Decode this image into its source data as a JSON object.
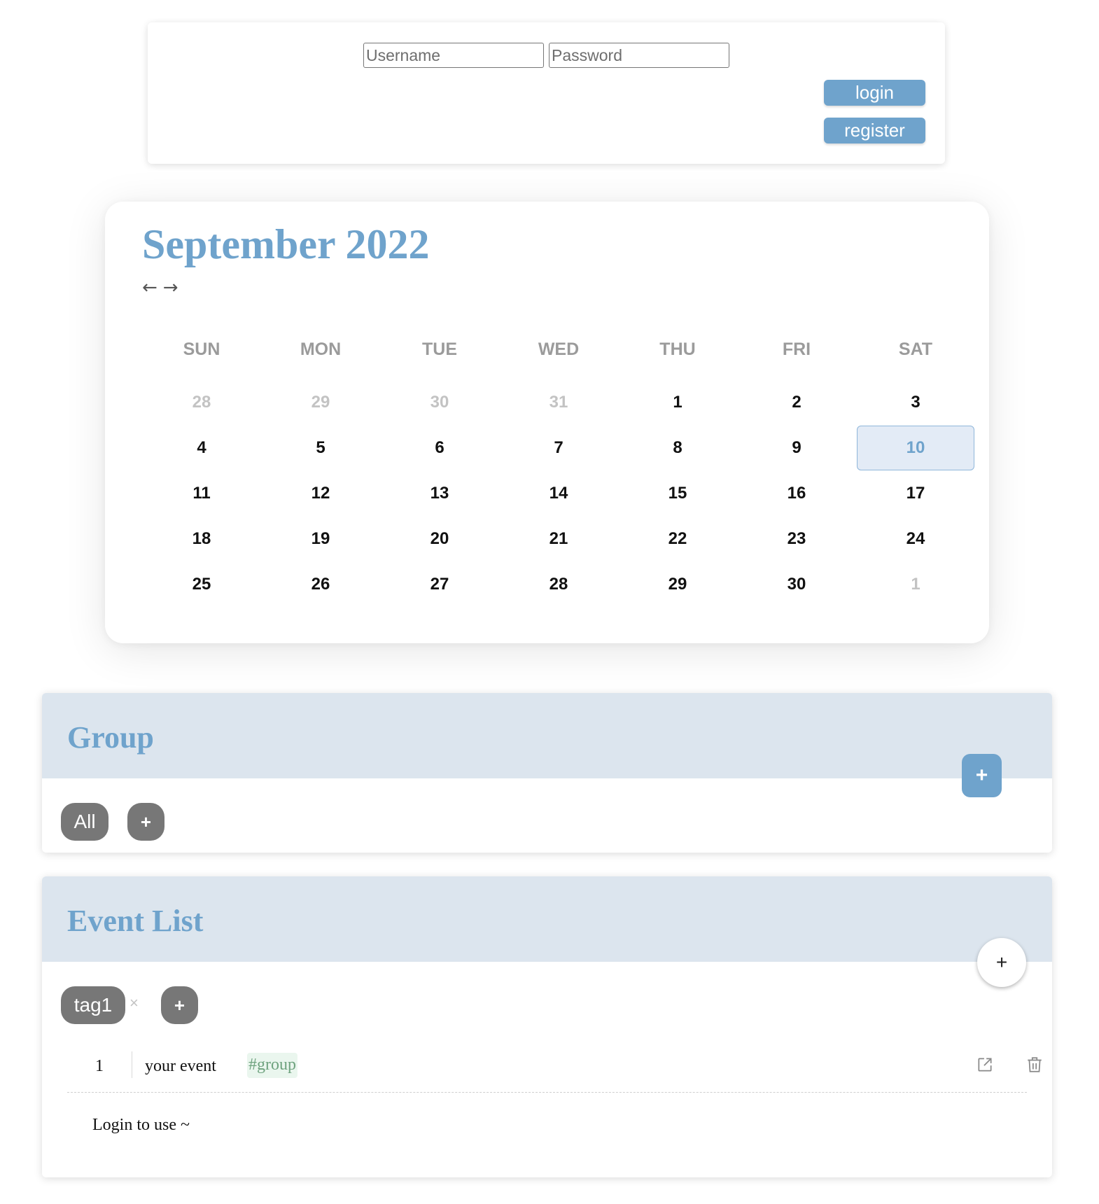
{
  "login": {
    "username_placeholder": "Username",
    "password_placeholder": "Password",
    "login_label": "login",
    "register_label": "register"
  },
  "calendar": {
    "title": "September 2022",
    "prev_arrow": "←",
    "next_arrow": "→",
    "weekdays": [
      "SUN",
      "MON",
      "TUE",
      "WED",
      "THU",
      "FRI",
      "SAT"
    ],
    "weeks": [
      [
        {
          "d": "28",
          "other": true
        },
        {
          "d": "29",
          "other": true
        },
        {
          "d": "30",
          "other": true
        },
        {
          "d": "31",
          "other": true
        },
        {
          "d": "1"
        },
        {
          "d": "2"
        },
        {
          "d": "3"
        }
      ],
      [
        {
          "d": "4"
        },
        {
          "d": "5"
        },
        {
          "d": "6"
        },
        {
          "d": "7"
        },
        {
          "d": "8"
        },
        {
          "d": "9"
        },
        {
          "d": "10",
          "selected": true
        }
      ],
      [
        {
          "d": "11"
        },
        {
          "d": "12"
        },
        {
          "d": "13"
        },
        {
          "d": "14"
        },
        {
          "d": "15"
        },
        {
          "d": "16"
        },
        {
          "d": "17"
        }
      ],
      [
        {
          "d": "18"
        },
        {
          "d": "19"
        },
        {
          "d": "20"
        },
        {
          "d": "21"
        },
        {
          "d": "22"
        },
        {
          "d": "23"
        },
        {
          "d": "24"
        }
      ],
      [
        {
          "d": "25"
        },
        {
          "d": "26"
        },
        {
          "d": "27"
        },
        {
          "d": "28"
        },
        {
          "d": "29"
        },
        {
          "d": "30"
        },
        {
          "d": "1",
          "other": true
        }
      ]
    ]
  },
  "group": {
    "title": "Group",
    "fab_label": "+",
    "all_label": "All",
    "add_label": "+"
  },
  "events": {
    "title": "Event List",
    "fab_label": "+",
    "tag_label": "tag1",
    "tag_remove": "×",
    "add_tag_label": "+",
    "items": [
      {
        "number": "1",
        "text": "your event",
        "tag": "#group"
      }
    ],
    "empty_message": "Login to use ~"
  },
  "colors": {
    "accent": "#6fa3cc",
    "header_bg": "#dce5ee",
    "selected_day_bg": "#e3ebf6",
    "pill_bg": "#777777",
    "tag_green": "#6fa37f"
  },
  "icons": [
    "edit-icon",
    "trash-icon"
  ]
}
